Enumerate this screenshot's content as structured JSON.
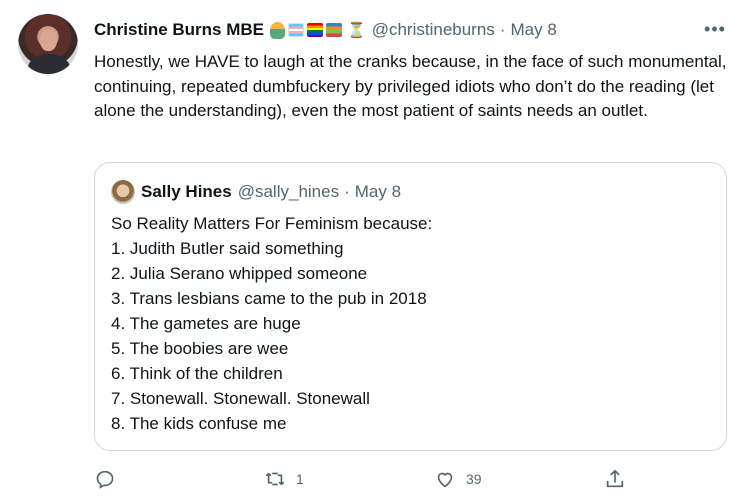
{
  "tweet": {
    "display_name": "Christine Burns MBE",
    "emoji_flags": [
      "mermaid",
      "trans-flag",
      "rainbow-flag",
      "books"
    ],
    "emoji_text": "⏳",
    "handle": "@christineburns",
    "separator": "·",
    "date": "May 8",
    "more_label": "•••",
    "text": "Honestly, we HAVE to laugh at the cranks because, in the face of such monumental, continuing, repeated dumbfuckery by privileged idiots who don’t do the reading (let alone the understanding), even the most patient of saints needs an outlet."
  },
  "quoted": {
    "display_name": "Sally Hines",
    "handle": "@sally_hines",
    "separator": "·",
    "date": "May 8",
    "lines": [
      "So Reality Matters For Feminism because:",
      "1. Judith Butler said something",
      "2. Julia Serano whipped someone",
      "3. Trans lesbians came to the pub in 2018",
      "4. The gametes are huge",
      "5. The boobies are wee",
      "6. Think of the children",
      "7. Stonewall. Stonewall. Stonewall",
      "8. The kids confuse me"
    ]
  },
  "actions": {
    "reply": {
      "icon": "reply-icon",
      "count": ""
    },
    "retweet": {
      "icon": "retweet-icon",
      "count": "1"
    },
    "like": {
      "icon": "heart-icon",
      "count": "39"
    },
    "share": {
      "icon": "share-icon",
      "count": ""
    }
  }
}
